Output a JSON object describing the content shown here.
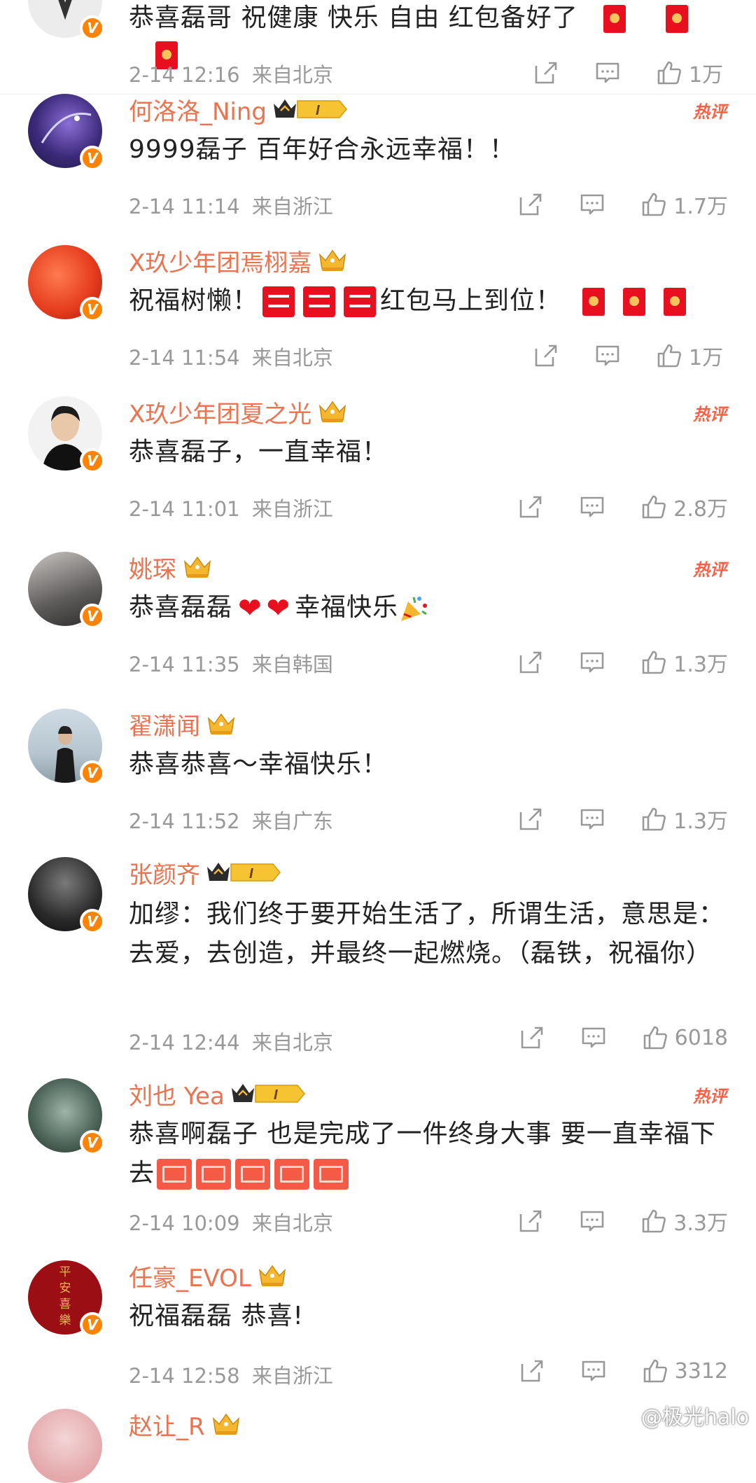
{
  "comments": [
    {
      "username": "",
      "text": "恭喜磊哥 祝健康 快乐 自由 红包备好了",
      "time": "2-14 12:16",
      "location": "来自北京",
      "likes": "1万",
      "hot": "",
      "emoji_suffix": [
        "red-envelope",
        "red-envelope",
        "red-envelope"
      ]
    },
    {
      "username": "何洛洛_Ning",
      "text": "9999磊子 百年好合永远幸福！！",
      "time": "2-14 11:14",
      "location": "来自浙江",
      "likes": "1.7万",
      "hot": "热评",
      "level": "I"
    },
    {
      "username": "X玖少年团焉栩嘉",
      "text_a": "祝福树懒！",
      "text_b": "红包马上到位！",
      "time": "2-14 11:54",
      "location": "来自北京",
      "likes": "1万",
      "hot": ""
    },
    {
      "username": "X玖少年团夏之光",
      "text": "恭喜磊子，一直幸福！",
      "time": "2-14 11:01",
      "location": "来自浙江",
      "likes": "2.8万",
      "hot": "热评"
    },
    {
      "username": "姚琛",
      "text_a": "恭喜磊磊",
      "text_b": "幸福快乐",
      "time": "2-14 11:35",
      "location": "来自韩国",
      "likes": "1.3万",
      "hot": "热评"
    },
    {
      "username": "翟潇闻",
      "text": "恭喜恭喜～幸福快乐！",
      "time": "2-14 11:52",
      "location": "来自广东",
      "likes": "1.3万",
      "hot": ""
    },
    {
      "username": "张颜齐",
      "text": "加缪：我们终于要开始生活了，所谓生活，意思是：去爱，去创造，并最终一起燃烧。（磊铁，祝福你）",
      "time": "2-14 12:44",
      "location": "来自北京",
      "likes": "6018",
      "hot": "",
      "level": "I"
    },
    {
      "username": "刘也 Yea",
      "text": "恭喜啊磊子  也是完成了一件终身大事  要一直幸福下去",
      "time": "2-14 10:09",
      "location": "来自北京",
      "likes": "3.3万",
      "hot": "热评",
      "level": "I"
    },
    {
      "username": "任豪_EVOL",
      "avatar_text": "平安喜樂",
      "text": "祝福磊磊 恭喜!",
      "time": "2-14 12:58",
      "location": "来自浙江",
      "likes": "3312",
      "hot": ""
    },
    {
      "username": "赵让_R",
      "hot": ""
    }
  ],
  "watermark": "@极光halo",
  "colors": {
    "username": "#eb7350",
    "meta": "#999999",
    "hot": "#ff6045",
    "verified": "#ff8200",
    "red_emoji": "#e8101f"
  },
  "icons": {
    "share": "share-icon",
    "comment": "comment-icon",
    "like": "thumbs-up-icon",
    "verified": "verified-v-icon",
    "crown": "crown-icon"
  }
}
